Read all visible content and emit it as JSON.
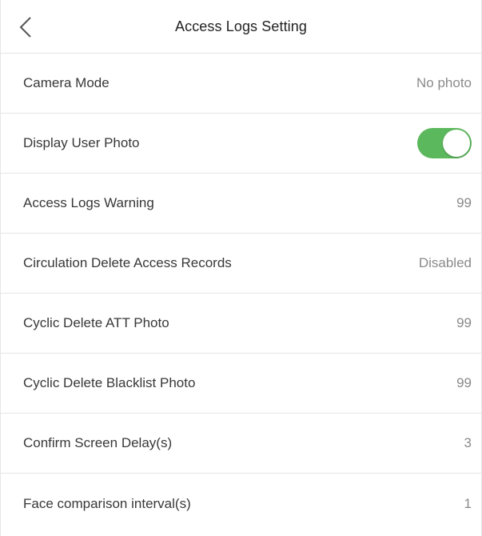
{
  "header": {
    "title": "Access Logs Setting"
  },
  "settings": [
    {
      "label": "Camera Mode",
      "value": "No photo",
      "type": "value"
    },
    {
      "label": "Display User Photo",
      "value": "on",
      "type": "toggle"
    },
    {
      "label": "Access Logs Warning",
      "value": "99",
      "type": "value"
    },
    {
      "label": "Circulation Delete Access Records",
      "value": "Disabled",
      "type": "value"
    },
    {
      "label": "Cyclic Delete ATT Photo",
      "value": "99",
      "type": "value"
    },
    {
      "label": "Cyclic Delete Blacklist Photo",
      "value": "99",
      "type": "value"
    },
    {
      "label": "Confirm Screen Delay(s)",
      "value": "3",
      "type": "value"
    },
    {
      "label": "Face comparison interval(s)",
      "value": "1",
      "type": "value"
    }
  ],
  "colors": {
    "toggle_on": "#5cb85c",
    "divider": "#e6e6e6"
  },
  "icons": {
    "back": "chevron-left-icon"
  }
}
